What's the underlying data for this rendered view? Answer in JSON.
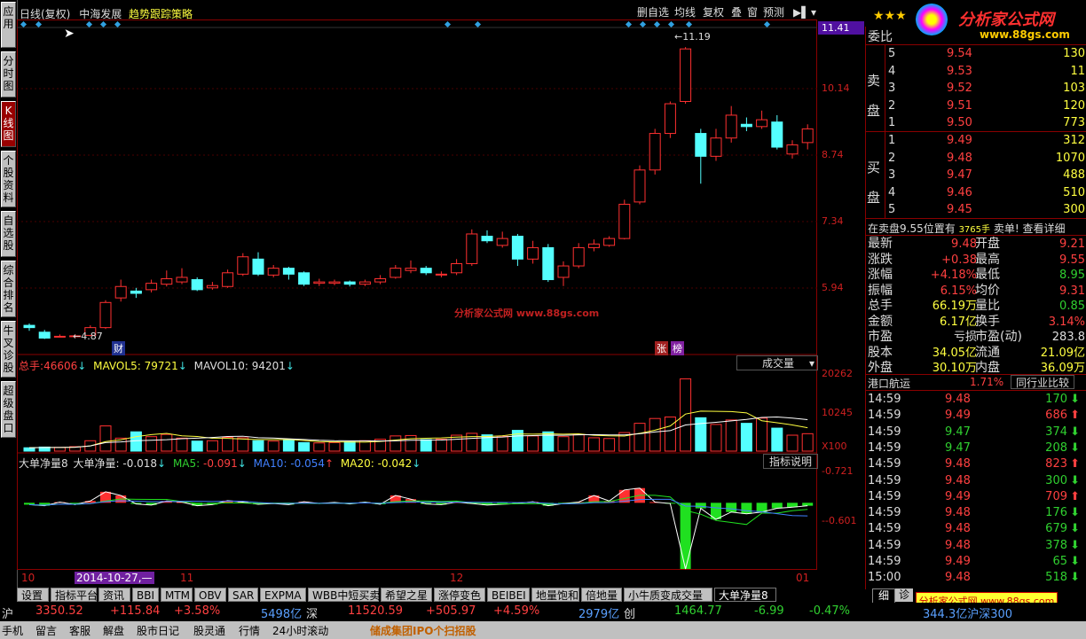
{
  "header": {
    "left_text": "日线(复权)",
    "stock_name": "中海发展",
    "strategy": "趋势跟踪策略",
    "toolbar": [
      "删自选",
      "均线",
      "复权",
      "叠",
      "窗",
      "预测"
    ]
  },
  "left_tabs": [
    {
      "label": "应用"
    },
    {
      "label": "分时图"
    },
    {
      "label": "K线图"
    },
    {
      "label": "个股资料"
    },
    {
      "label": "自选股"
    },
    {
      "label": "综合排名"
    },
    {
      "label": "牛叉诊股"
    },
    {
      "label": "超级盘口"
    }
  ],
  "logo": {
    "text": "分析家公式网",
    "url": "www.88gs.com"
  },
  "watermark": "分析家公式网 www.88gs.com",
  "price_axis": {
    "current": "11.41",
    "ticks": [
      "10.14",
      "8.74",
      "7.34",
      "5.94"
    ],
    "max_label": "11.19",
    "min_label": "4.87"
  },
  "chart_data": [
    {
      "type": "candlestick",
      "title": "日线(复权)",
      "ylim": [
        4.5,
        11.6
      ],
      "candles": [
        [
          5.1,
          5.05,
          5.14,
          4.98
        ],
        [
          4.95,
          4.82,
          5.0,
          4.8
        ],
        [
          4.86,
          4.86,
          4.9,
          4.84
        ],
        [
          4.86,
          4.87,
          4.9,
          4.84
        ],
        [
          4.88,
          5.05,
          5.1,
          4.86
        ],
        [
          5.05,
          5.6,
          5.65,
          5.02
        ],
        [
          5.7,
          5.95,
          6.1,
          5.62
        ],
        [
          5.85,
          5.8,
          5.92,
          5.7
        ],
        [
          5.88,
          6.02,
          6.1,
          5.82
        ],
        [
          6.0,
          6.12,
          6.3,
          5.95
        ],
        [
          6.05,
          6.15,
          6.35,
          6.0
        ],
        [
          6.1,
          5.88,
          6.15,
          5.85
        ],
        [
          5.92,
          5.97,
          6.05,
          5.88
        ],
        [
          5.95,
          6.25,
          6.32,
          5.92
        ],
        [
          6.22,
          6.6,
          6.68,
          6.18
        ],
        [
          6.55,
          6.22,
          6.7,
          6.18
        ],
        [
          6.2,
          6.35,
          6.42,
          6.15
        ],
        [
          6.35,
          6.22,
          6.38,
          6.1
        ],
        [
          6.25,
          6.0,
          6.28,
          5.96
        ],
        [
          6.02,
          6.05,
          6.12,
          5.96
        ],
        [
          6.02,
          6.05,
          6.1,
          5.98
        ],
        [
          6.05,
          6.0,
          6.08,
          5.95
        ],
        [
          6.0,
          6.05,
          6.1,
          5.96
        ],
        [
          6.05,
          6.12,
          6.2,
          6.0
        ],
        [
          6.15,
          6.35,
          6.42,
          6.12
        ],
        [
          6.3,
          6.35,
          6.52,
          6.24
        ],
        [
          6.35,
          6.25,
          6.4,
          6.2
        ],
        [
          6.2,
          6.22,
          6.28,
          6.15
        ],
        [
          6.25,
          6.45,
          6.55,
          6.2
        ],
        [
          6.45,
          7.1,
          7.2,
          6.4
        ],
        [
          7.05,
          6.95,
          7.18,
          6.9
        ],
        [
          6.85,
          7.0,
          7.15,
          6.8
        ],
        [
          7.05,
          6.55,
          7.1,
          6.4
        ],
        [
          6.55,
          6.8,
          6.95,
          6.45
        ],
        [
          6.8,
          6.1,
          6.88,
          6.05
        ],
        [
          6.15,
          6.4,
          6.5,
          5.96
        ],
        [
          6.4,
          6.8,
          6.9,
          6.35
        ],
        [
          6.8,
          6.88,
          6.98,
          6.72
        ],
        [
          6.85,
          7.0,
          7.05,
          6.82
        ],
        [
          7.0,
          7.75,
          7.85,
          6.98
        ],
        [
          7.8,
          8.5,
          8.6,
          7.75
        ],
        [
          8.5,
          9.3,
          9.4,
          8.4
        ],
        [
          9.3,
          9.95,
          10.0,
          9.2
        ],
        [
          10.0,
          11.15,
          11.19,
          9.95
        ],
        [
          9.3,
          8.8,
          9.4,
          8.2
        ],
        [
          8.8,
          9.2,
          9.4,
          8.7
        ],
        [
          9.2,
          9.7,
          9.9,
          9.1
        ],
        [
          9.5,
          9.45,
          9.65,
          9.35
        ],
        [
          9.45,
          9.6,
          9.8,
          9.4
        ],
        [
          9.55,
          9.0,
          9.7,
          8.95
        ],
        [
          8.85,
          9.05,
          9.15,
          8.75
        ],
        [
          9.1,
          9.4,
          9.5,
          8.95
        ]
      ],
      "markers": [
        "财",
        "张",
        "榜"
      ]
    },
    {
      "type": "bar",
      "title": "成交量",
      "legend": {
        "name": "总手",
        "value": "46606",
        "ma5_label": "MAVOL5",
        "ma5": "79721",
        "ma10_label": "MAVOL10",
        "ma10": "94201"
      },
      "axis_labels": [
        "20262",
        "10245",
        "X100"
      ],
      "ylim": [
        0,
        22000
      ],
      "values": [
        900,
        1100,
        1000,
        1200,
        2800,
        6800,
        3500,
        5200,
        3900,
        4500,
        3500,
        2700,
        2800,
        3700,
        3600,
        2800,
        2700,
        2900,
        2300,
        2200,
        2300,
        2500,
        2800,
        3200,
        4100,
        4200,
        3100,
        3200,
        4300,
        4800,
        4400,
        4000,
        5600,
        4100,
        5200,
        3900,
        4500,
        3600,
        3400,
        5000,
        7500,
        8800,
        9200,
        19500,
        9000,
        7200,
        8400,
        7500,
        8900,
        6200,
        4300,
        4700
      ]
    },
    {
      "type": "bar",
      "title": "大单净量8",
      "legend": {
        "name": "大单净量",
        "value": "-0.018",
        "ma5_label": "MA5",
        "ma5": "-0.091",
        "ma10_label": "MA10",
        "ma10": "-0.054",
        "ma20_label": "MA20",
        "ma20": "-0.042"
      },
      "axis_labels": [
        "0.721",
        "-0.601"
      ],
      "button": "指标说明",
      "ylim": [
        -1.8,
        0.9
      ],
      "values": [
        -0.05,
        -0.08,
        0.02,
        -0.05,
        0.05,
        0.3,
        0.2,
        -0.03,
        -0.06,
        0.05,
        0.02,
        -0.08,
        -0.05,
        0.06,
        0.02,
        -0.04,
        -0.02,
        -0.05,
        0.03,
        -0.02,
        0.01,
        -0.03,
        0.02,
        -0.04,
        0.2,
        0.1,
        -0.03,
        -0.05,
        0.02,
        -0.02,
        -0.06,
        -0.04,
        -0.02,
        0.03,
        -0.08,
        -0.02,
        0.02,
        0.2,
        0.05,
        0.35,
        0.4,
        0.02,
        -0.02,
        -1.8,
        -0.15,
        -0.45,
        -0.25,
        -0.3,
        -0.25,
        -0.15,
        -0.12,
        -0.08
      ]
    }
  ],
  "x_axis": {
    "labels": [
      "10",
      "11",
      "12",
      "01"
    ],
    "highlight": "2014-10-27,—"
  },
  "right_panel": {
    "title": "委比",
    "sell_label": "卖盘",
    "buy_label": "买盘",
    "sell": [
      {
        "n": "5",
        "price": "9.54",
        "vol": "130"
      },
      {
        "n": "4",
        "price": "9.53",
        "vol": "11"
      },
      {
        "n": "3",
        "price": "9.52",
        "vol": "103"
      },
      {
        "n": "2",
        "price": "9.51",
        "vol": "120"
      },
      {
        "n": "1",
        "price": "9.50",
        "vol": "773"
      }
    ],
    "buy": [
      {
        "n": "1",
        "price": "9.49",
        "vol": "312"
      },
      {
        "n": "2",
        "price": "9.48",
        "vol": "1070"
      },
      {
        "n": "3",
        "price": "9.47",
        "vol": "488"
      },
      {
        "n": "4",
        "price": "9.46",
        "vol": "510"
      },
      {
        "n": "5",
        "price": "9.45",
        "vol": "300"
      }
    ],
    "info_line": {
      "a": "在卖盘9.55位置有",
      "b": "3765手",
      "c": "卖单!",
      "d": "查看详细"
    },
    "stats": [
      {
        "l1": "最新",
        "v1": "9.48",
        "l2": "开盘",
        "v2": "9.21"
      },
      {
        "l1": "涨跌",
        "v1": "+0.38",
        "l2": "最高",
        "v2": "9.55"
      },
      {
        "l1": "涨幅",
        "v1": "+4.18%",
        "l2": "最低",
        "v2": "8.95"
      },
      {
        "l1": "振幅",
        "v1": "6.15%",
        "l2": "均价",
        "v2": "9.31"
      },
      {
        "l1": "总手",
        "v1": "66.19万",
        "l2": "量比",
        "v2": "0.85"
      },
      {
        "l1": "金额",
        "v1": "6.17亿",
        "l2": "换手",
        "v2": "3.14%"
      },
      {
        "l1": "市盈",
        "v1": "亏损",
        "l2": "市盈(动)",
        "v2": "283.8"
      },
      {
        "l1": "股本",
        "v1": "34.05亿",
        "l2": "流通",
        "v2": "21.09亿"
      },
      {
        "l1": "外盘",
        "v1": "30.10万",
        "l2": "内盘",
        "v2": "36.09万"
      }
    ],
    "industry": {
      "name": "港口航运",
      "pct": "1.71%",
      "button": "同行业比较"
    },
    "ticks": [
      {
        "t": "14:59",
        "p": "9.48",
        "v": "170",
        "d": "down"
      },
      {
        "t": "14:59",
        "p": "9.49",
        "v": "686",
        "d": "up"
      },
      {
        "t": "14:59",
        "p": "9.47",
        "v": "374",
        "d": "down"
      },
      {
        "t": "14:59",
        "p": "9.47",
        "v": "208",
        "d": "down"
      },
      {
        "t": "14:59",
        "p": "9.48",
        "v": "823",
        "d": "up"
      },
      {
        "t": "14:59",
        "p": "9.48",
        "v": "300",
        "d": "down"
      },
      {
        "t": "14:59",
        "p": "9.49",
        "v": "709",
        "d": "up"
      },
      {
        "t": "14:59",
        "p": "9.48",
        "v": "176",
        "d": "down"
      },
      {
        "t": "14:59",
        "p": "9.48",
        "v": "679",
        "d": "down"
      },
      {
        "t": "14:59",
        "p": "9.48",
        "v": "378",
        "d": "down"
      },
      {
        "t": "14:59",
        "p": "9.49",
        "v": "65",
        "d": "down"
      },
      {
        "t": "15:00",
        "p": "9.48",
        "v": "518",
        "d": "down"
      }
    ],
    "bottom_tabs": [
      "细",
      "诊"
    ]
  },
  "bottom_tabs": [
    "设置",
    "指标平台",
    "资讯",
    "BBI",
    "MTM",
    "OBV",
    "SAR",
    "EXPMA",
    "WBB中短买卖",
    "希望之星",
    "涨停变色",
    "BEIBEI",
    "地量饱和",
    "倍地量",
    "小牛质变成交量",
    "大单净量8"
  ],
  "status_bar": {
    "sh_label": "沪",
    "sh_index": "3350.52",
    "sh_chg": "+115.84",
    "sh_pct": "+3.58%",
    "sh_amt": "5498亿",
    "sz_label": "深",
    "sz_index": "11520.59",
    "sz_chg": "+505.97",
    "sz_pct": "+4.59%",
    "sz_amt": "2979亿",
    "cy_label": "创",
    "cy_index": "1464.77",
    "cy_chg": "-6.99",
    "cy_pct": "-0.47%",
    "tail": "344.3亿沪深300"
  },
  "status2": [
    "手机",
    "留言",
    "客服",
    "解盘",
    "股市日记",
    "股灵通",
    "行情",
    "24小时滚动"
  ],
  "status2_news": "储成集团IPO个扫招股",
  "colors": {
    "up": "#ff3030",
    "down": "#54ffff",
    "green": "#20e020",
    "bg": "#000000",
    "grid": "#8a0000"
  }
}
